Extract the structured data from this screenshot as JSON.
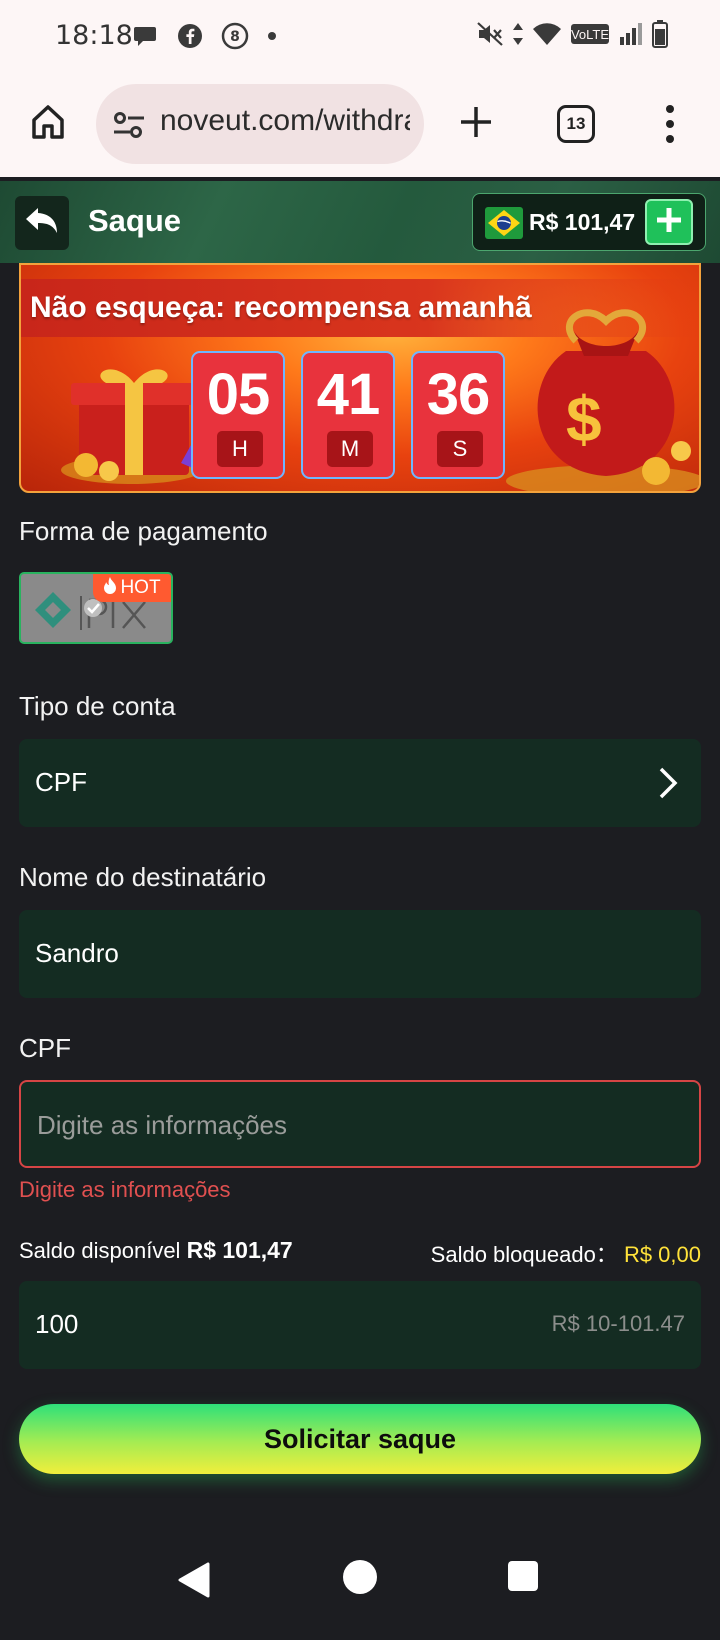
{
  "status_bar": {
    "time": "18:18",
    "icons_left": [
      "chat-bubble-icon",
      "facebook-icon",
      "circle-8-icon",
      "dot-icon"
    ],
    "icons_right": [
      "mute-icon",
      "data-arrows-icon",
      "wifi-icon",
      "volte-icon",
      "signal-icon",
      "battery-icon"
    ],
    "volte_label": "VoLTE"
  },
  "browser": {
    "url": "noveut.com/withdraw",
    "tab_count": "13"
  },
  "header": {
    "title": "Saque",
    "balance": "R$ 101,47"
  },
  "banner": {
    "title": "Não esqueça: recompensa amanhã",
    "timer": [
      {
        "value": "05",
        "unit": "H"
      },
      {
        "value": "41",
        "unit": "M"
      },
      {
        "value": "36",
        "unit": "S"
      }
    ]
  },
  "form": {
    "payment_label": "Forma de pagamento",
    "payment_method": {
      "name": "pix",
      "badge": "HOT"
    },
    "account_type_label": "Tipo de conta",
    "account_type_value": "CPF",
    "recipient_label": "Nome do destinatário",
    "recipient_value": "Sandro",
    "cpf_label": "CPF",
    "cpf_placeholder": "Digite as informações",
    "cpf_error": "Digite as informações",
    "available_label": "Saldo disponível",
    "available_value": "R$ 101,47",
    "blocked_label": "Saldo bloqueado：",
    "blocked_value": "R$ 0,00",
    "amount_value": "100",
    "amount_range": "R$ 10-101.47",
    "submit_label": "Solicitar saque"
  },
  "colors": {
    "accent_green": "#1fc15a",
    "error_red": "#e05050",
    "highlight_yellow": "#ffe23a",
    "field_bg": "#142c22",
    "page_bg": "#1c1d21"
  }
}
